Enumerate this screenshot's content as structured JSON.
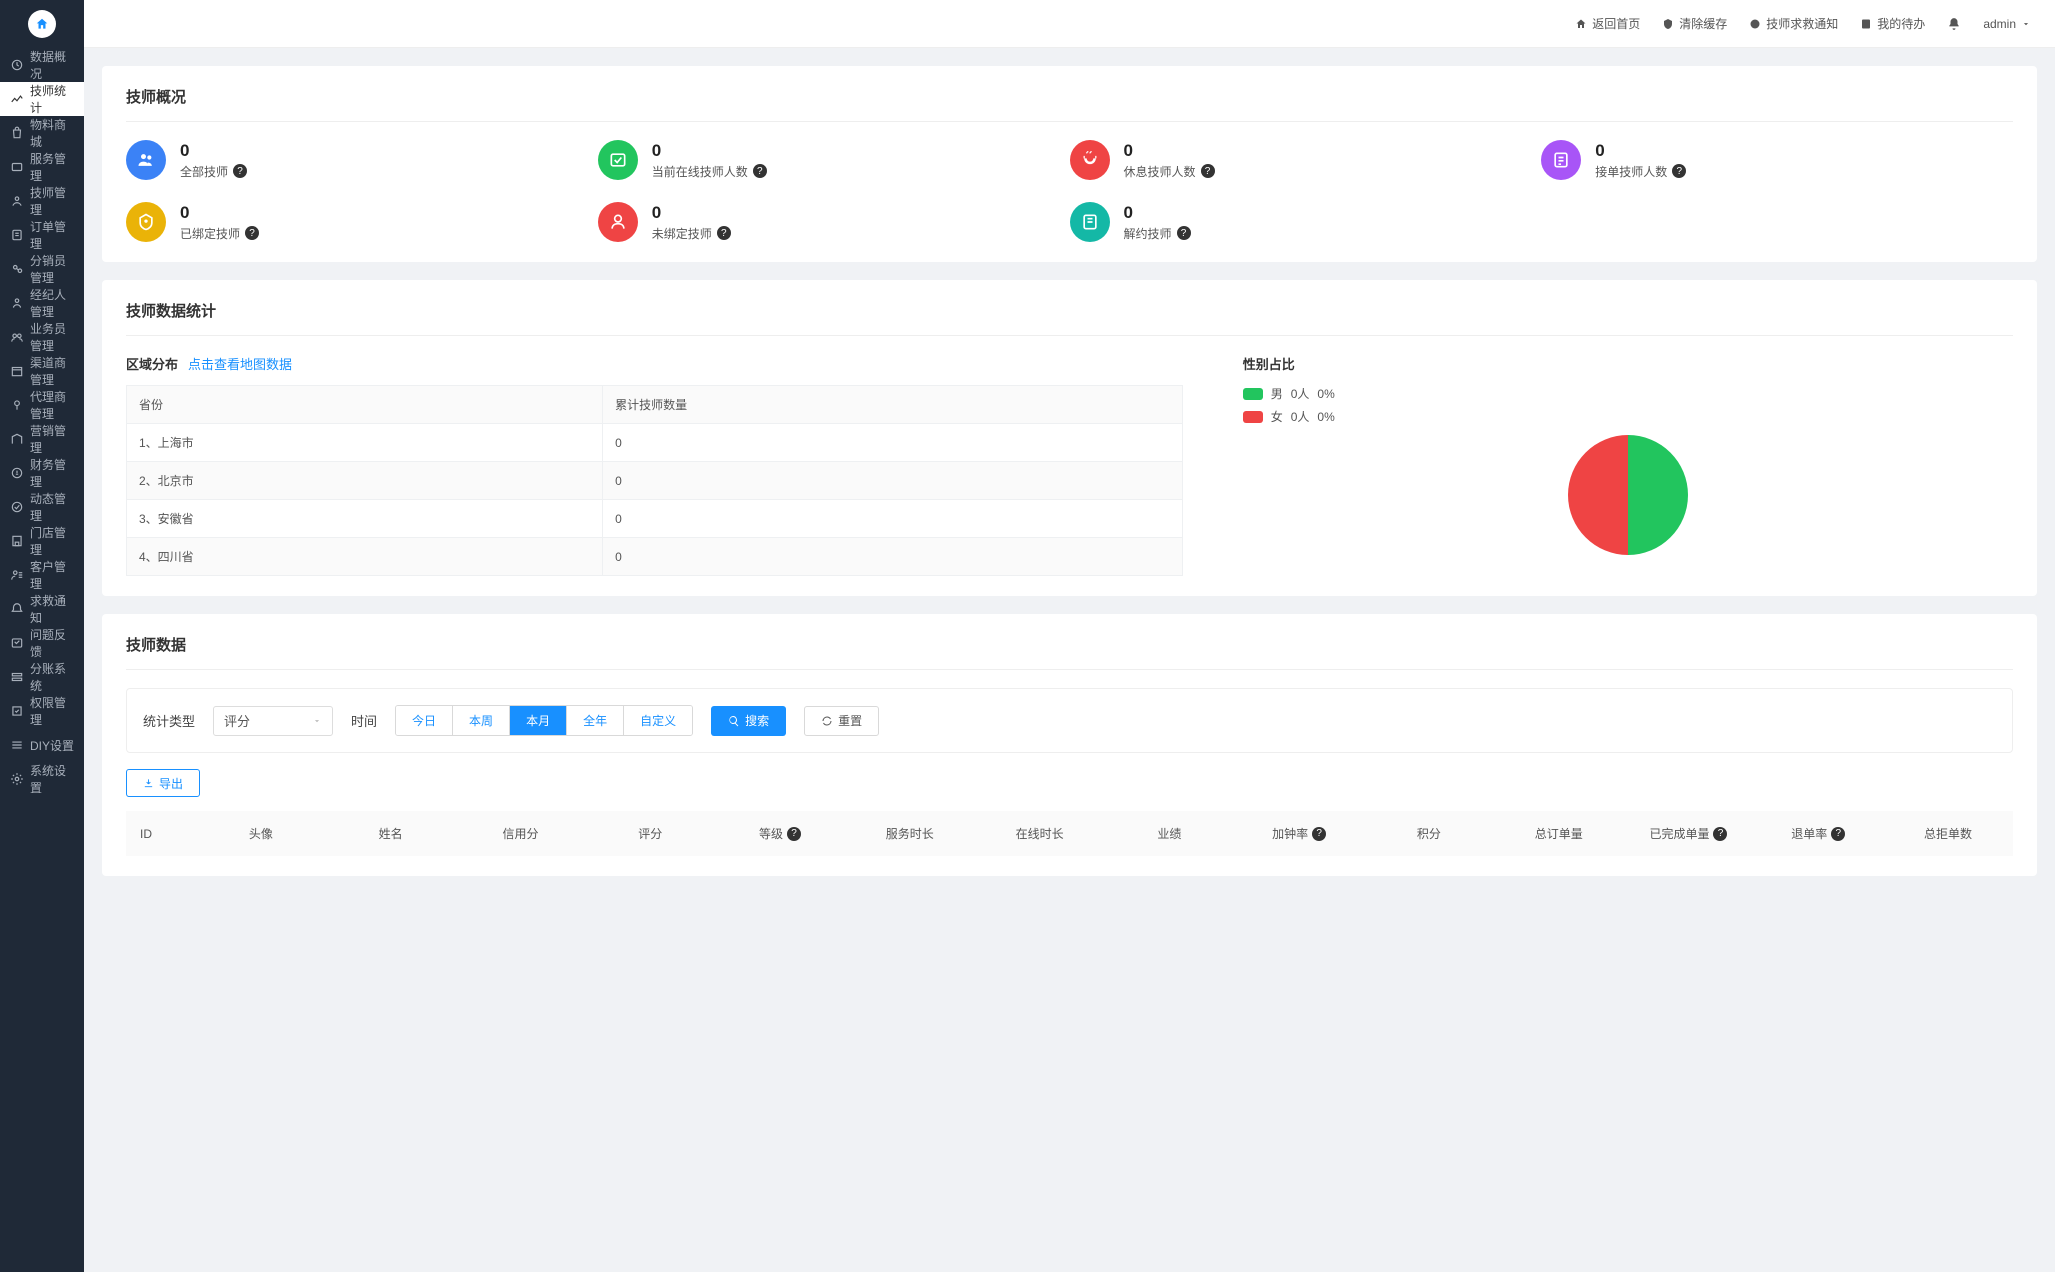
{
  "sidebar": {
    "items": [
      {
        "label": "数据概况"
      },
      {
        "label": "技师统计"
      },
      {
        "label": "物料商城"
      },
      {
        "label": "服务管理"
      },
      {
        "label": "技师管理"
      },
      {
        "label": "订单管理"
      },
      {
        "label": "分销员管理"
      },
      {
        "label": "经纪人管理"
      },
      {
        "label": "业务员管理"
      },
      {
        "label": "渠道商管理"
      },
      {
        "label": "代理商管理"
      },
      {
        "label": "营销管理"
      },
      {
        "label": "财务管理"
      },
      {
        "label": "动态管理"
      },
      {
        "label": "门店管理"
      },
      {
        "label": "客户管理"
      },
      {
        "label": "求救通知"
      },
      {
        "label": "问题反馈"
      },
      {
        "label": "分账系统"
      },
      {
        "label": "权限管理"
      },
      {
        "label": "DIY设置"
      },
      {
        "label": "系统设置"
      }
    ],
    "active_index": 1
  },
  "header": {
    "home": "返回首页",
    "clear_cache": "清除缓存",
    "sos": "技师求救通知",
    "todo": "我的待办",
    "user": "admin"
  },
  "overview": {
    "title": "技师概况",
    "items": [
      {
        "value": "0",
        "label": "全部技师",
        "color": "#3b82f6"
      },
      {
        "value": "0",
        "label": "当前在线技师人数",
        "color": "#22c55e"
      },
      {
        "value": "0",
        "label": "休息技师人数",
        "color": "#ef4444"
      },
      {
        "value": "0",
        "label": "接单技师人数",
        "color": "#a855f7"
      },
      {
        "value": "0",
        "label": "已绑定技师",
        "color": "#eab308"
      },
      {
        "value": "0",
        "label": "未绑定技师",
        "color": "#ef4444"
      },
      {
        "value": "0",
        "label": "解约技师",
        "color": "#14b8a6"
      }
    ]
  },
  "stats": {
    "title": "技师数据统计",
    "region": {
      "title": "区域分布",
      "link": "点击查看地图数据",
      "headers": [
        "省份",
        "累计技师数量"
      ],
      "rows": [
        {
          "idx": "1、",
          "name": "上海市",
          "count": "0"
        },
        {
          "idx": "2、",
          "name": "北京市",
          "count": "0"
        },
        {
          "idx": "3、",
          "name": "安徽省",
          "count": "0"
        },
        {
          "idx": "4、",
          "name": "四川省",
          "count": "0"
        }
      ]
    },
    "gender": {
      "title": "性别占比",
      "male": {
        "label": "男",
        "people": "0人",
        "pct": "0%",
        "color": "#22c55e"
      },
      "female": {
        "label": "女",
        "people": "0人",
        "pct": "0%",
        "color": "#ef4444"
      }
    }
  },
  "datalist": {
    "title": "技师数据",
    "filter": {
      "type_label": "统计类型",
      "type_value": "评分",
      "time_label": "时间",
      "time_options": [
        "今日",
        "本周",
        "本月",
        "全年",
        "自定义"
      ],
      "time_active": 2,
      "search": "搜索",
      "reset": "重置",
      "export": "导出"
    },
    "columns": [
      "ID",
      "头像",
      "姓名",
      "信用分",
      "评分",
      "等级",
      "服务时长",
      "在线时长",
      "业绩",
      "加钟率",
      "积分",
      "总订单量",
      "已完成单量",
      "退单率",
      "总拒单数"
    ],
    "help_cols": [
      5,
      9,
      12,
      13
    ]
  },
  "chart_data": {
    "type": "pie",
    "title": "性别占比",
    "series": [
      {
        "name": "男",
        "value": 0,
        "display_people": "0人",
        "display_pct": "0%",
        "color": "#22c55e"
      },
      {
        "name": "女",
        "value": 0,
        "display_people": "0人",
        "display_pct": "0%",
        "color": "#ef4444"
      }
    ],
    "note": "Both values are 0; chart rendered as 50/50 placeholder split."
  }
}
